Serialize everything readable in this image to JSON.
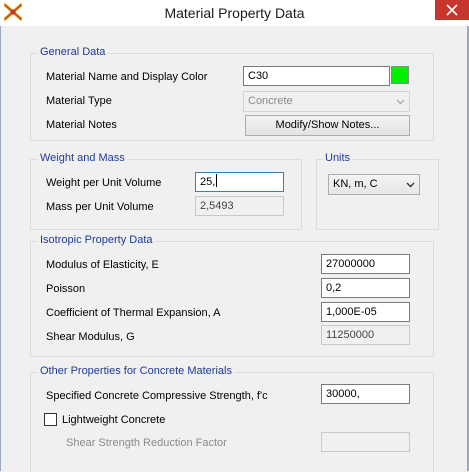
{
  "window": {
    "title": "Material Property Data"
  },
  "general": {
    "legend": "General Data",
    "name_label": "Material Name and Display Color",
    "name_value": "C30",
    "display_color": "#00ee00",
    "type_label": "Material Type",
    "type_value": "Concrete",
    "notes_label": "Material Notes",
    "notes_button": "Modify/Show Notes..."
  },
  "weight": {
    "legend": "Weight and Mass",
    "weight_label": "Weight per Unit Volume",
    "weight_value": "25,",
    "mass_label": "Mass per Unit Volume",
    "mass_value": "2,5493"
  },
  "units": {
    "legend": "Units",
    "value": "KN, m, C"
  },
  "isotropic": {
    "legend": "Isotropic Property Data",
    "modulus_label": "Modulus of Elasticity,  E",
    "modulus_value": "27000000",
    "poisson_label": "Poisson",
    "poisson_value": "0,2",
    "thermal_label": "Coefficient of Thermal Expansion,  A",
    "thermal_value": "1,000E-05",
    "shear_label": "Shear Modulus,  G",
    "shear_value": "11250000"
  },
  "concrete": {
    "legend": "Other Properties for Concrete Materials",
    "fc_label": "Specified Concrete Compressive Strength, f'c",
    "fc_value": "30000,",
    "lightweight_label": "Lightweight Concrete",
    "lightweight_checked": false,
    "shear_reduction_label": "Shear Strength Reduction Factor",
    "shear_reduction_value": ""
  },
  "colors": {
    "legend_text": "#1f3a93",
    "close_button": "#c7372f"
  },
  "icons": {
    "app": "sap-logo-icon",
    "close": "close-icon",
    "dropdown": "chevron-down-icon"
  }
}
